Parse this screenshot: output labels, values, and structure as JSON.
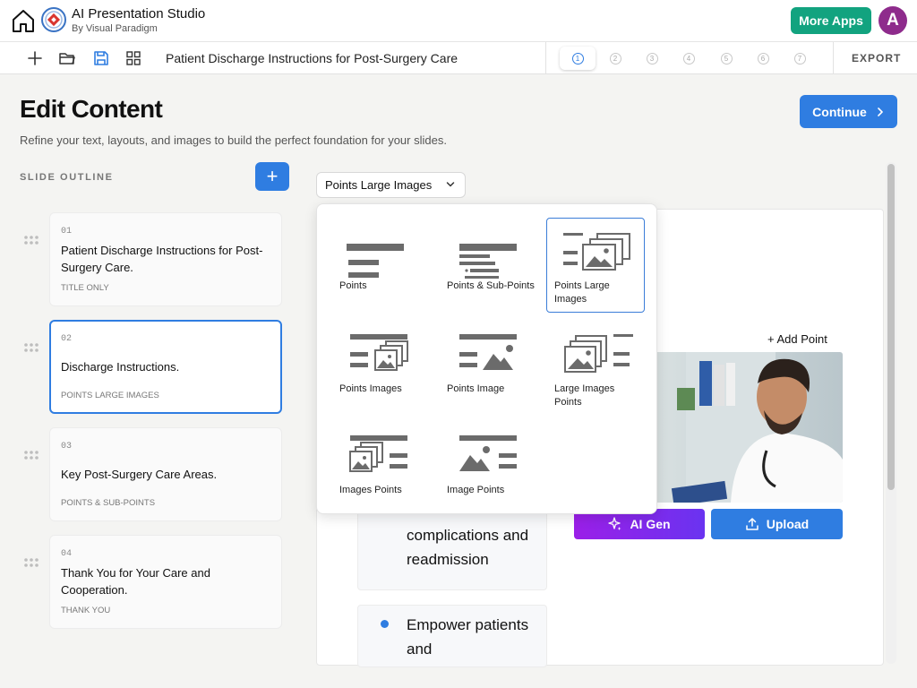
{
  "app": {
    "title": "AI Presentation Studio",
    "subtitle": "By Visual Paradigm",
    "more_apps_label": "More Apps",
    "avatar_letter": "A"
  },
  "toolbar": {
    "document_title": "Patient Discharge Instructions for Post-Surgery Care",
    "steps": [
      "1",
      "2",
      "3",
      "4",
      "5",
      "6",
      "7"
    ],
    "active_step": "1",
    "export_label": "EXPORT"
  },
  "header": {
    "title": "Edit Content",
    "subtitle": "Refine your text, layouts, and images to build the perfect foundation for your slides.",
    "continue_label": "Continue"
  },
  "outline": {
    "label": "SLIDE OUTLINE",
    "add_label": "+",
    "slides": [
      {
        "num": "01",
        "title": "Patient Discharge Instructions for Post-Surgery Care.",
        "type": "TITLE ONLY"
      },
      {
        "num": "02",
        "title": "Discharge Instructions.",
        "type": "POINTS LARGE IMAGES"
      },
      {
        "num": "03",
        "title": "Key Post-Surgery Care Areas.",
        "type": "POINTS & SUB-POINTS"
      },
      {
        "num": "04",
        "title": "Thank You for Your Care and Cooperation.",
        "type": "THANK YOU"
      }
    ]
  },
  "editor": {
    "layout_selected": "Points Large Images",
    "add_point_label": "+ Add Point",
    "ai_gen_label": "AI Gen",
    "upload_label": "Upload",
    "points": [
      {
        "text": "complications and readmission"
      },
      {
        "text": "Empower patients and"
      }
    ]
  },
  "layouts": [
    {
      "label": "Points"
    },
    {
      "label": "Points & Sub-Points"
    },
    {
      "label": "Points Large Images"
    },
    {
      "label": "Points Images"
    },
    {
      "label": "Points Image"
    },
    {
      "label": "Large Images Points"
    },
    {
      "label": "Images Points"
    },
    {
      "label": "Image Points"
    }
  ],
  "colors": {
    "accent": "#2f7de1",
    "more_apps": "#12a37f",
    "avatar": "#8e2b8c",
    "ai_gen_start": "#9b1fe8",
    "ai_gen_end": "#6a33f0"
  },
  "icons": [
    "home-icon",
    "logo-icon",
    "plus-icon",
    "folder-icon",
    "save-icon",
    "grid-icon",
    "chevron-right-icon",
    "chevron-down-icon",
    "drag-handle-icon",
    "sparkle-icon",
    "upload-icon"
  ]
}
